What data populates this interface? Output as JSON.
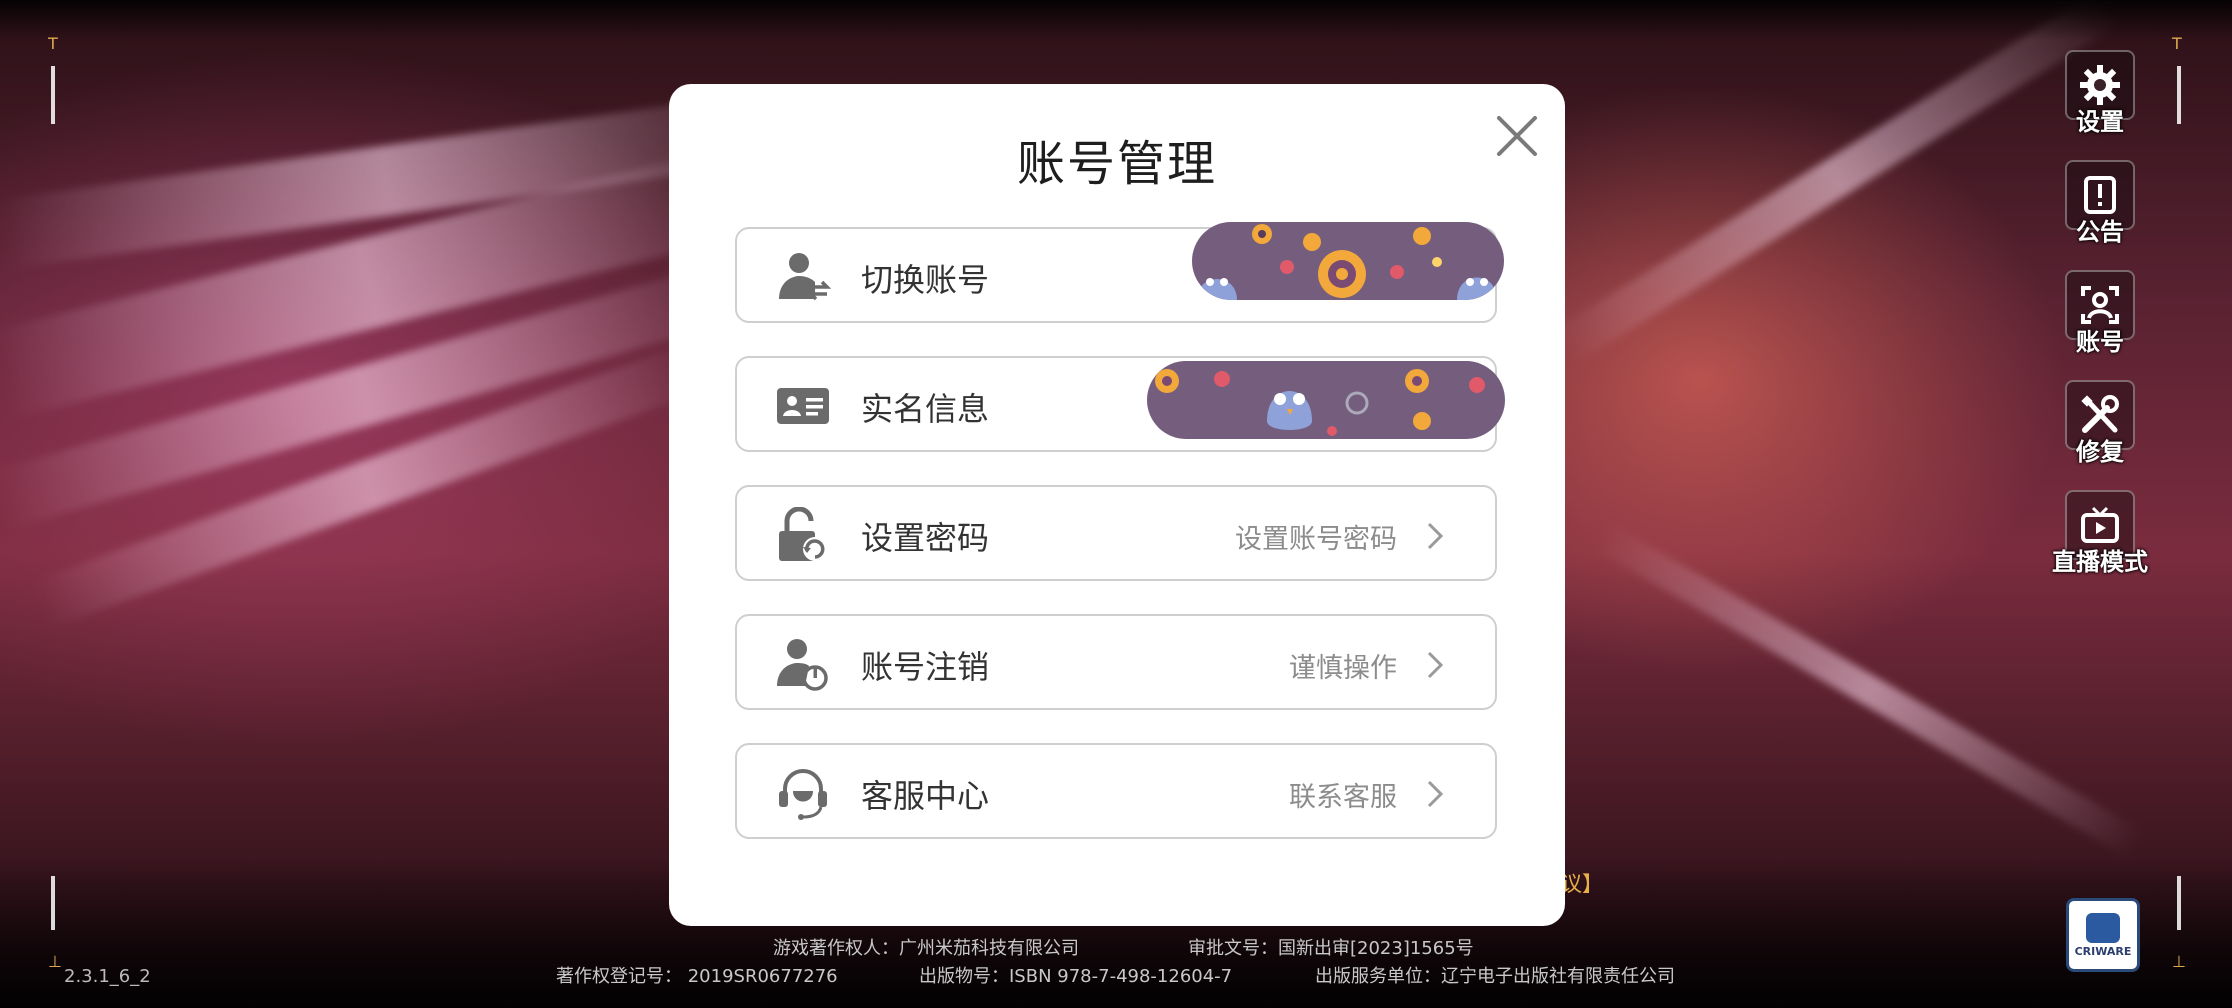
{
  "modal": {
    "title": "账号管理",
    "rows": [
      {
        "label": "切换账号",
        "hint": ""
      },
      {
        "label": "实名信息",
        "hint": ""
      },
      {
        "label": "设置密码",
        "hint": "设置账号密码"
      },
      {
        "label": "账号注销",
        "hint": "谨慎操作"
      },
      {
        "label": "客服中心",
        "hint": "联系客服"
      }
    ]
  },
  "sidebar": {
    "items": [
      {
        "label": "设置",
        "icon": "gear-icon"
      },
      {
        "label": "公告",
        "icon": "notice-icon"
      },
      {
        "label": "账号",
        "icon": "account-icon"
      },
      {
        "label": "修复",
        "icon": "repair-icon"
      },
      {
        "label": "直播模式",
        "icon": "live-tv-icon"
      }
    ]
  },
  "footer": {
    "version": "2.3.1_6_2",
    "agreement_fragment": "协议】",
    "copyright_owner": "游戏著作权人：广州米茄科技有限公司",
    "approval": "审批文号：国新出审[2023]1565号",
    "registration": "著作权登记号： 2019SR0677276",
    "isbn": "出版物号：ISBN 978-7-498-12604-7",
    "publisher": "出版服务单位：辽宁电子出版社有限责任公司"
  },
  "criware": {
    "label": "CRIWARE"
  },
  "colors": {
    "accent": "#e9b049",
    "modal_bg": "#ffffff",
    "icon_gray": "#6b6b6b",
    "sticker_purple": "#755d7e"
  }
}
